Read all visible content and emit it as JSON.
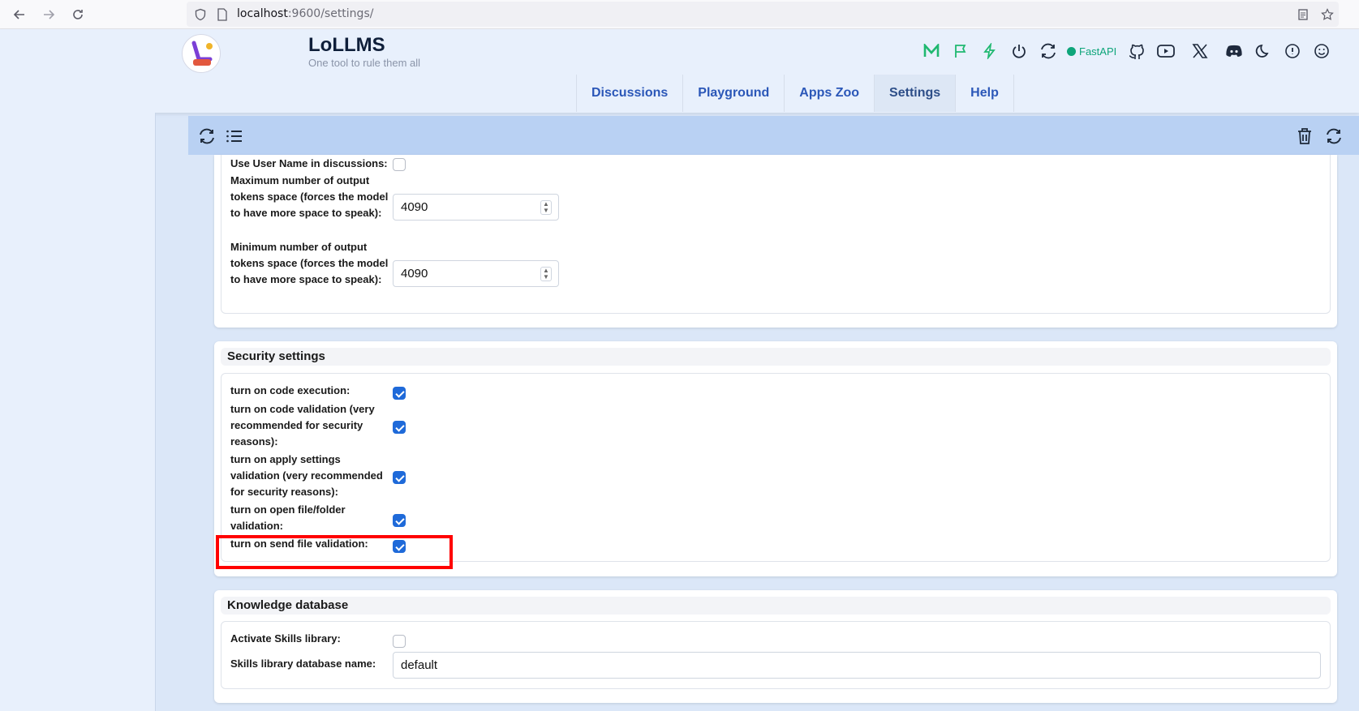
{
  "browser": {
    "url_host": "localhost",
    "url_rest": ":9600/settings/"
  },
  "app": {
    "title": "LoLLMS",
    "subtitle": "One tool to rule them all",
    "logo_icon": "lollms-logo",
    "fastapi_label": "FastAPI"
  },
  "tabs": [
    {
      "label": "Discussions",
      "active": false
    },
    {
      "label": "Playground",
      "active": false
    },
    {
      "label": "Apps Zoo",
      "active": false
    },
    {
      "label": "Settings",
      "active": true
    },
    {
      "label": "Help",
      "active": false
    }
  ],
  "generation_settings": {
    "use_user_name_label": "Use User Name in discussions:",
    "use_user_name_checked": false,
    "max_tokens_label": "Maximum number of output tokens space (forces the model to have more space to speak):",
    "max_tokens_value": "4090",
    "min_tokens_label": "Minimum number of output tokens space (forces the model to have more space to speak):",
    "min_tokens_value": "4090"
  },
  "security_settings": {
    "title": "Security settings",
    "items": [
      {
        "label": "turn on code execution:",
        "checked": true
      },
      {
        "label": "turn on code validation (very recommended for security reasons):",
        "checked": true
      },
      {
        "label": "turn on apply settings validation (very recommended for security reasons):",
        "checked": true
      },
      {
        "label": "turn on open file/folder validation:",
        "checked": true
      },
      {
        "label": "turn on send file validation:",
        "checked": true
      }
    ]
  },
  "knowledge_database": {
    "title": "Knowledge database",
    "skills_label": "Activate Skills library:",
    "skills_checked": false,
    "db_name_label": "Skills library database name:",
    "db_name_value": "default"
  },
  "colors": {
    "accent": "#1f6ad9",
    "highlight": "#ff0000",
    "toolbar": "#b9d1f3"
  }
}
